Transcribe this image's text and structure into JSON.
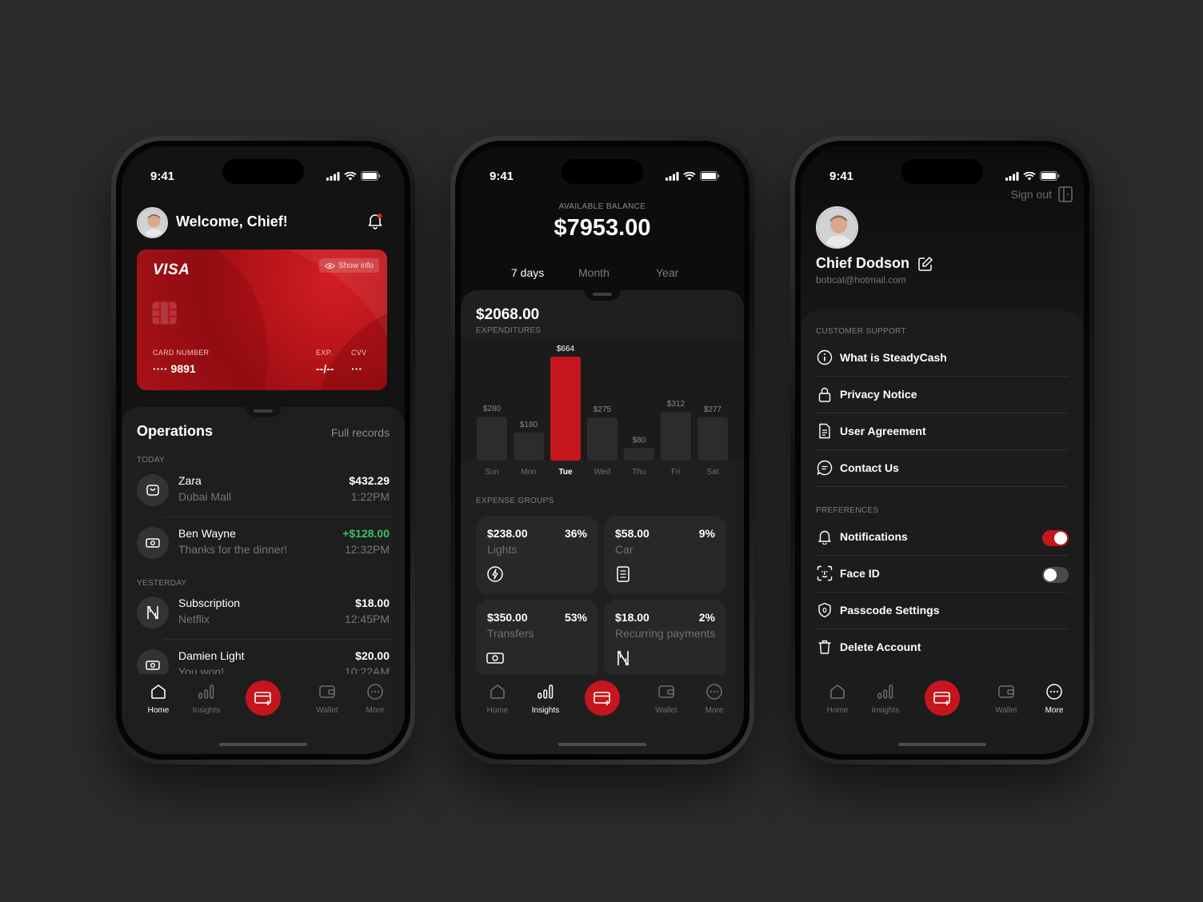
{
  "status": {
    "time": "9:41"
  },
  "home": {
    "welcome": "Welcome, Chief!",
    "card": {
      "brand": "VISA",
      "show_info": "Show info",
      "number_label": "CARD NUMBER",
      "number_value": "···· 9891",
      "exp_label": "EXP.",
      "exp_value": "--/--",
      "cvv_label": "CVV",
      "cvv_value": "···"
    },
    "operations_title": "Operations",
    "full_records": "Full records",
    "today_label": "TODAY",
    "yesterday_label": "YESTERDAY",
    "operations": [
      {
        "title": "Zara",
        "subtitle": "Dubai Mall",
        "amount": "$432.29",
        "time": "1:22PM",
        "icon": "bag-icon",
        "positive": false
      },
      {
        "title": "Ben Wayne",
        "subtitle": "Thanks for the dinner!",
        "amount": "+$128.00",
        "time": "12:32PM",
        "icon": "money-icon",
        "positive": true
      },
      {
        "title": "Subscription",
        "subtitle": "Netflix",
        "amount": "$18.00",
        "time": "12:45PM",
        "icon": "netflix-icon",
        "positive": false
      },
      {
        "title": "Damien Light",
        "subtitle": "You won!",
        "amount": "$20.00",
        "time": "10:22AM",
        "icon": "money-icon",
        "positive": false
      }
    ],
    "positive_color": "#3ec25c"
  },
  "tabs": [
    {
      "label": "Home",
      "icon": "home-icon"
    },
    {
      "label": "Insights",
      "icon": "insights-icon"
    },
    {
      "label": "Wallet",
      "icon": "wallet-icon"
    },
    {
      "label": "More",
      "icon": "more-icon"
    }
  ],
  "insights": {
    "balance_label": "AVAILABLE BALANCE",
    "balance": "$7953.00",
    "periods": [
      "7 days",
      "Month",
      "Year"
    ],
    "expenditures": "$2068.00",
    "expenditures_label": "EXPENDITURES",
    "expense_groups_label": "EXPENSE GROUPS",
    "groups": [
      {
        "amount": "$238.00",
        "percent": "36%",
        "name": "Lights",
        "icon": "bolt-icon"
      },
      {
        "amount": "$58.00",
        "percent": "9%",
        "name": "Car",
        "icon": "receipt-icon"
      },
      {
        "amount": "$350.00",
        "percent": "53%",
        "name": "Transfers",
        "icon": "money-icon"
      },
      {
        "amount": "$18.00",
        "percent": "2%",
        "name": "Recurring payments",
        "icon": "netflix-icon"
      }
    ]
  },
  "chart_data": {
    "type": "bar",
    "categories": [
      "Sun",
      "Mon",
      "Tue",
      "Wed",
      "Thu",
      "Fri",
      "Sat"
    ],
    "values": [
      280,
      180,
      664,
      275,
      80,
      312,
      277
    ],
    "labels": [
      "$280",
      "$180",
      "$664",
      "$275",
      "$80",
      "$312",
      "$277"
    ],
    "highlight": "Tue",
    "highlight_color": "#c4161c",
    "ylim": [
      0,
      664
    ]
  },
  "more": {
    "sign_out": "Sign out",
    "name": "Chief Dodson",
    "email": "bobcat@hotmail.com",
    "support_label": "CUSTOMER SUPPORT",
    "support_items": [
      {
        "label": "What is SteadyCash",
        "icon": "info-icon"
      },
      {
        "label": "Privacy Notice",
        "icon": "lock-icon"
      },
      {
        "label": "User Agreement",
        "icon": "document-icon"
      },
      {
        "label": "Contact Us",
        "icon": "chat-icon"
      }
    ],
    "preferences_label": "PREFERENCES",
    "preference_items": [
      {
        "label": "Notifications",
        "icon": "bell-icon",
        "toggle": true,
        "on": true
      },
      {
        "label": "Face ID",
        "icon": "face-id-icon",
        "toggle": true,
        "on": false
      },
      {
        "label": "Passcode Settings",
        "icon": "shield-icon",
        "toggle": false
      },
      {
        "label": "Delete Account",
        "icon": "trash-icon",
        "toggle": false
      }
    ]
  }
}
